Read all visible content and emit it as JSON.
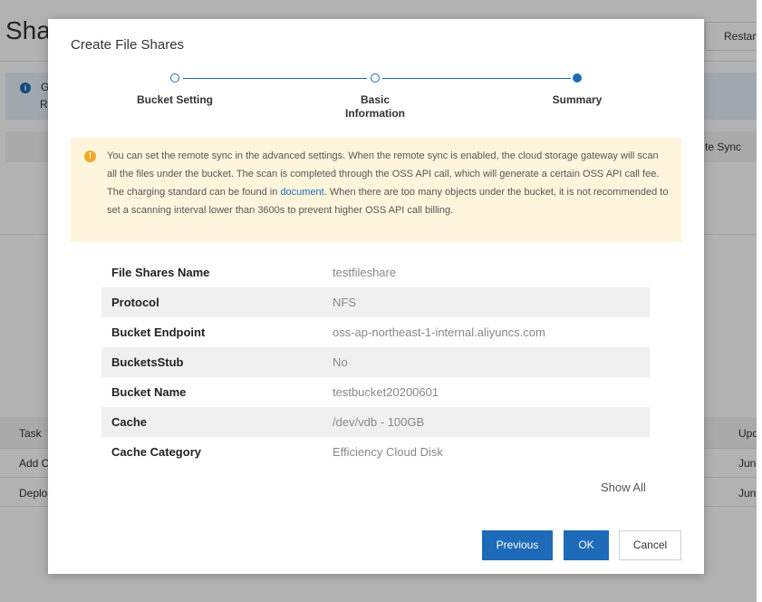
{
  "background": {
    "page_title": "Sha",
    "restart_button": "Restart",
    "info_line1": "G",
    "info_line2": "R",
    "remote_sync_header": "te Sync",
    "task_table": {
      "task_header": "Task",
      "update_header": "Upd",
      "rows": [
        {
          "task": "Add C",
          "update": "June"
        },
        {
          "task": "Deplo",
          "update": "June"
        }
      ]
    }
  },
  "modal": {
    "title": "Create File Shares",
    "steps": [
      {
        "label": "Bucket Setting",
        "state": "done"
      },
      {
        "label": "Basic Information",
        "label_line1": "Basic",
        "label_line2": "Information",
        "state": "done"
      },
      {
        "label": "Summary",
        "state": "current"
      }
    ],
    "notice": {
      "text_before_link": "You can set the remote sync in the advanced settings. When the remote sync is enabled, the cloud storage gateway will scan all the files under the bucket. The scan is completed through the OSS API call, which will generate a certain OSS API call fee. The charging standard can be found in ",
      "link_text": "document",
      "text_after_link": ". When there are too many objects under the bucket, it is not recommended to set a scanning interval lower than 3600s to prevent higher OSS API call billing."
    },
    "summary_rows": [
      {
        "key": "File Shares Name",
        "value": "testfileshare"
      },
      {
        "key": "Protocol",
        "value": "NFS"
      },
      {
        "key": "Bucket Endpoint",
        "value": "oss-ap-northeast-1-internal.aliyuncs.com"
      },
      {
        "key": "BucketsStub",
        "value": "No"
      },
      {
        "key": "Bucket Name",
        "value": "testbucket20200601"
      },
      {
        "key": "Cache",
        "value": "/dev/vdb - 100GB"
      },
      {
        "key": "Cache Category",
        "value": "Efficiency Cloud Disk"
      }
    ],
    "show_all": "Show All",
    "buttons": {
      "previous": "Previous",
      "ok": "OK",
      "cancel": "Cancel"
    }
  },
  "colors": {
    "accent": "#1c6ab8",
    "notice_bg": "#fff5dc",
    "warning_icon": "#f5a623",
    "overlay": "rgba(0,0,0,0.30)"
  },
  "icons": {
    "info": "info-icon",
    "warning": "warning-icon"
  }
}
